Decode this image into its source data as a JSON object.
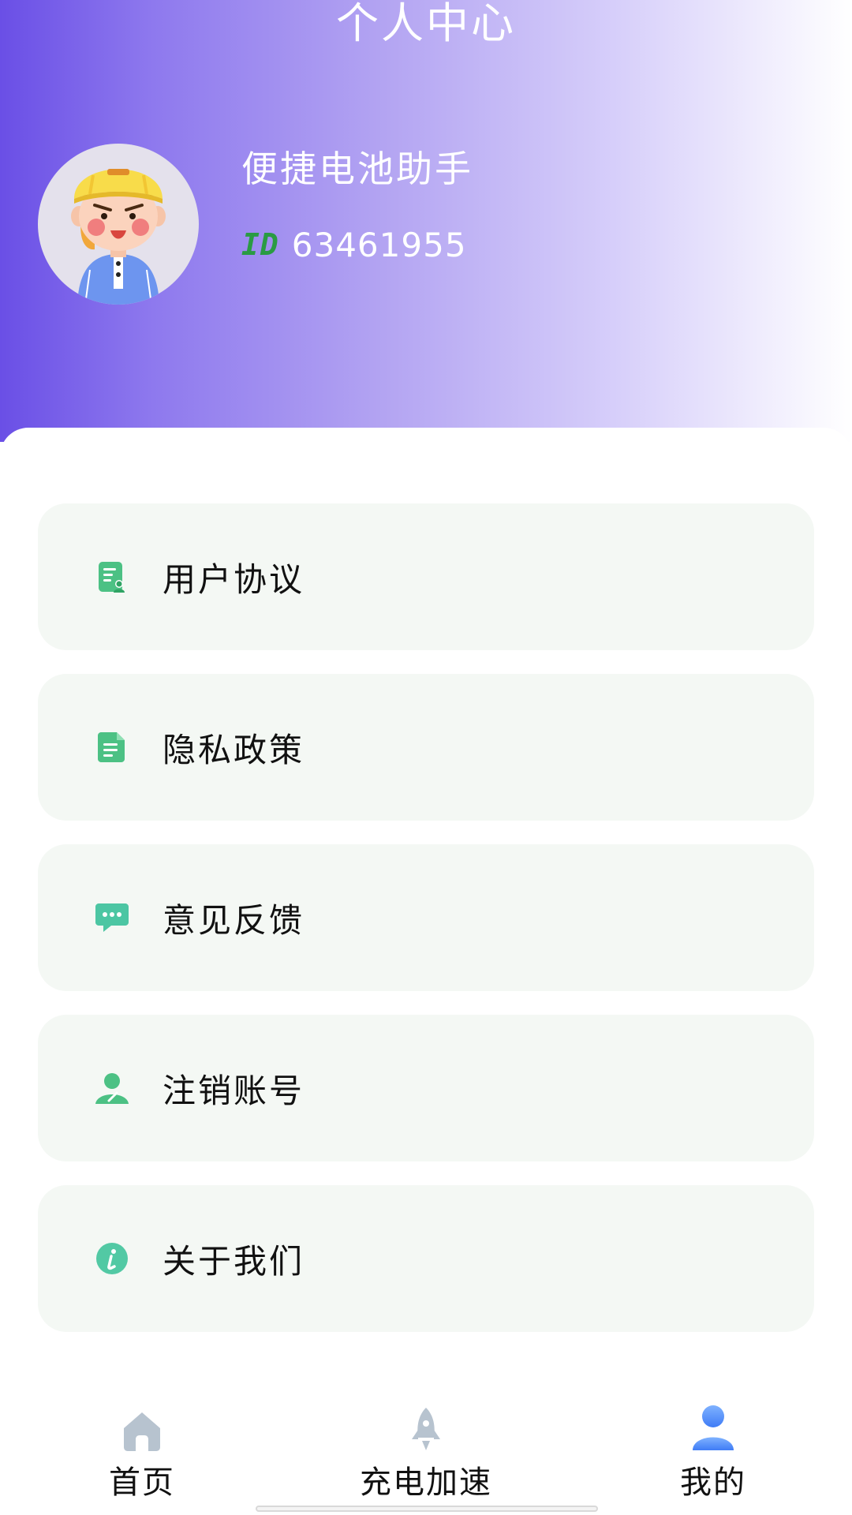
{
  "header": {
    "title": "个人中心",
    "app_name": "便捷电池助手",
    "id_label": "ID",
    "id_value": "63461955"
  },
  "menu": [
    {
      "label": "用户协议",
      "icon": "document-user-icon"
    },
    {
      "label": "隐私政策",
      "icon": "document-icon"
    },
    {
      "label": "意见反馈",
      "icon": "chat-bubble-icon"
    },
    {
      "label": "注销账号",
      "icon": "user-edit-icon"
    },
    {
      "label": "关于我们",
      "icon": "info-icon"
    }
  ],
  "bottom_nav": [
    {
      "label": "首页",
      "icon": "home-icon",
      "active": false
    },
    {
      "label": "充电加速",
      "icon": "rocket-icon",
      "active": false
    },
    {
      "label": "我的",
      "icon": "profile-icon",
      "active": true
    }
  ],
  "colors": {
    "header_gradient_start": "#6a4fe6",
    "accent_green": "#2a9b43",
    "menu_icon_green": "#3cc07a",
    "nav_active": "#3f7cf6",
    "nav_inactive": "#b7c3cf"
  }
}
